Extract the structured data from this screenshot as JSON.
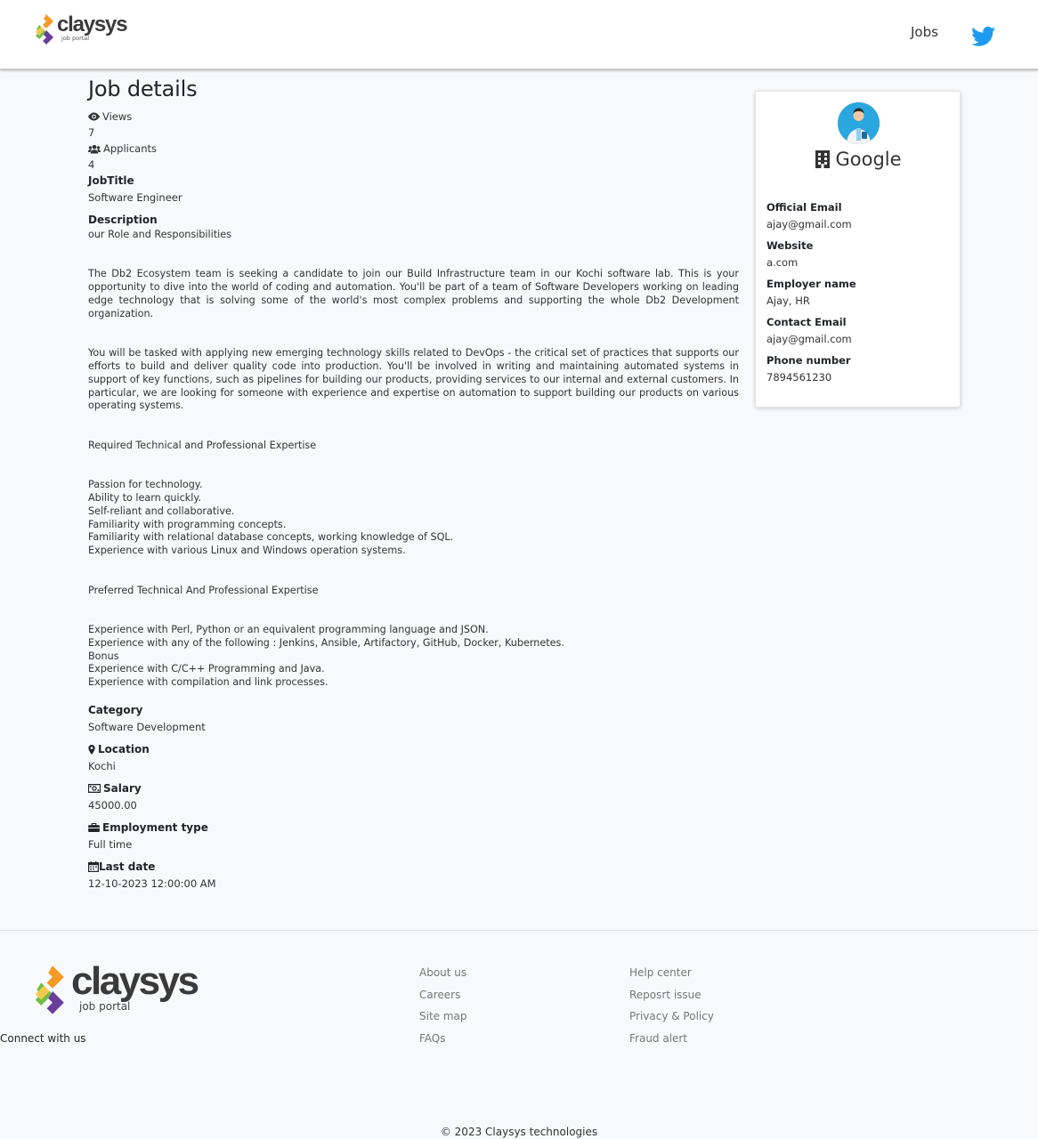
{
  "header": {
    "logo_brand": "claysys",
    "logo_sub": "job portal",
    "nav_jobs": "Jobs"
  },
  "colors": {
    "twitter": "#1d9bf0",
    "logo_green": "#6fbf44",
    "logo_orange": "#f59a23",
    "logo_purple": "#6a3d9a",
    "avatar_bg": "#2aa7de"
  },
  "job": {
    "page_title": "Job details",
    "views_label": "Views",
    "views_value": "7",
    "applicants_label": "Applicants",
    "applicants_value": "4",
    "jobtitle_label": "JobTitle",
    "jobtitle_value": "Software Engineer",
    "description_label": "Description",
    "description_intro": "our Role and Responsibilities",
    "para1": "The Db2 Ecosystem team is seeking a candidate to join our Build Infrastructure team in our Kochi software lab. This is your opportunity to dive into the world of coding and automation. You'll be part of a team of Software Developers working on leading edge technology that is solving some of the world's most complex problems and supporting the whole Db2 Development organization.",
    "para2": "You will be tasked with applying new emerging technology skills related to DevOps - the critical set of practices that supports our efforts to build and deliver quality code into production. You'll be involved in writing and maintaining automated systems in support of key functions, such as pipelines for building our products, providing services to our internal and external customers. In particular, we are looking for someone with experience and expertise on automation to support building our products on various operating systems.",
    "required_heading": "Required Technical and Professional Expertise",
    "required_items": [
      "Passion for technology.",
      "Ability to learn quickly.",
      "Self-reliant and collaborative.",
      "Familiarity with programming concepts.",
      "Familiarity with relational database concepts, working knowledge of SQL.",
      "Experience with various Linux and Windows operation systems."
    ],
    "preferred_heading": "Preferred Technical And Professional Expertise",
    "preferred_items": [
      "Experience with Perl, Python or an equivalent programming language and JSON.",
      "Experience with any of the following : Jenkins, Ansible, Artifactory, GitHub, Docker, Kubernetes.",
      "Bonus",
      "Experience with C/C++ Programming and Java.",
      "Experience with compilation and link processes."
    ],
    "category_label": "Category",
    "category_value": "Software Development",
    "location_label": "Location",
    "location_value": "Kochi",
    "salary_label": "Salary",
    "salary_value": "45000.00",
    "employment_label": "Employment type",
    "employment_value": "Full time",
    "lastdate_label": "Last date",
    "lastdate_value": "12-10-2023 12:00:00 AM"
  },
  "company": {
    "name": "Google",
    "official_email_label": "Official Email",
    "official_email": "ajay@gmail.com",
    "website_label": "Website",
    "website": "a.com",
    "employer_name_label": "Employer name",
    "employer_name": "Ajay, HR",
    "contact_email_label": "Contact Email",
    "contact_email": "ajay@gmail.com",
    "phone_label": "Phone number",
    "phone": "7894561230"
  },
  "footer": {
    "logo_brand": "claysys",
    "logo_sub": "job portal",
    "connect": "Connect with us",
    "col1": [
      "About us",
      "Careers",
      "Site map",
      "FAQs"
    ],
    "col2": [
      "Help center",
      "Reposrt issue",
      "Privacy & Policy",
      "Fraud alert"
    ],
    "copyright": "© 2023 Claysys technologies"
  }
}
